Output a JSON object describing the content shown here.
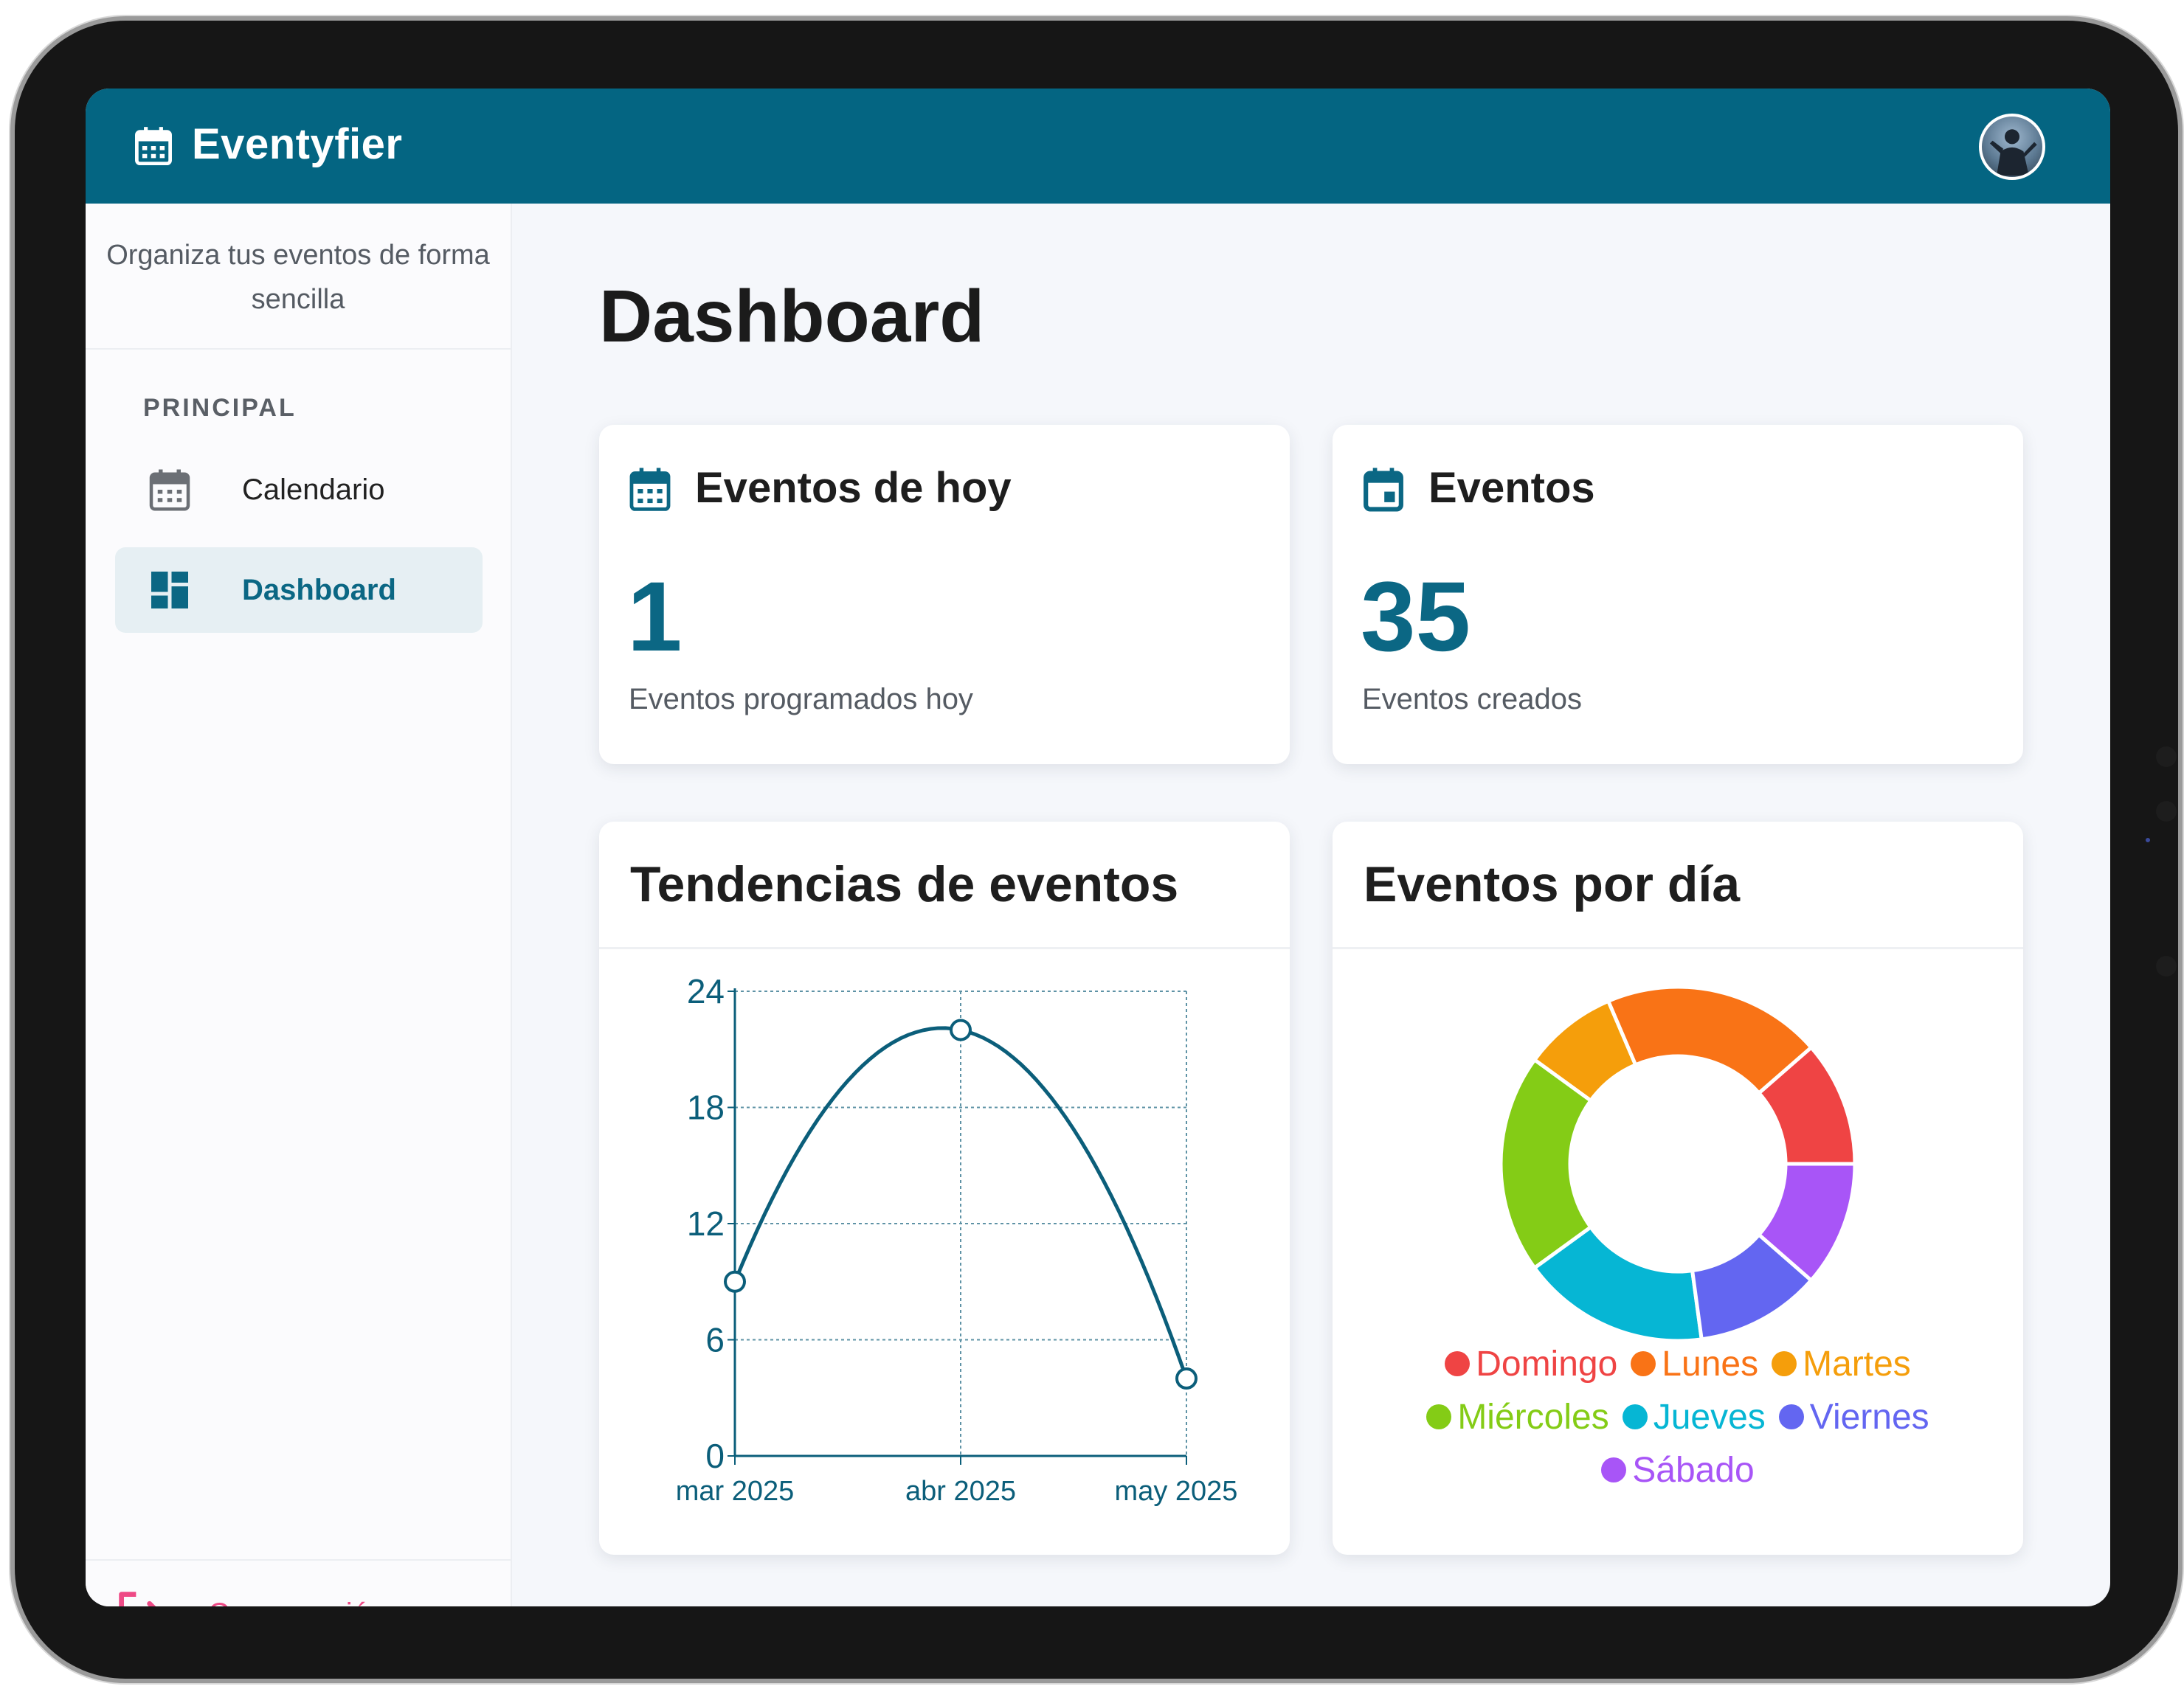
{
  "app": {
    "name": "Eventyfier",
    "brand_icon": "calendar-icon",
    "accent_color": "#046582"
  },
  "sidebar": {
    "tagline": "Organiza tus eventos de forma sencilla",
    "section_label": "PRINCIPAL",
    "items": [
      {
        "label": "Calendario",
        "icon": "calendar-icon",
        "active": false
      },
      {
        "label": "Dashboard",
        "icon": "dashboard-icon",
        "active": true
      }
    ],
    "logout_label": "Cerrar sesión",
    "logout_color": "#ee4a86"
  },
  "main": {
    "title": "Dashboard",
    "stats": [
      {
        "title": "Eventos de hoy",
        "icon": "calendar-icon",
        "value": "1",
        "caption": "Eventos programados hoy"
      },
      {
        "title": "Eventos",
        "icon": "event-icon",
        "value": "35",
        "caption": "Eventos creados"
      }
    ]
  },
  "chart_data": [
    {
      "type": "line",
      "title": "Tendencias de eventos",
      "x": [
        "mar 2025",
        "abr 2025",
        "may 2025"
      ],
      "series": [
        {
          "values": [
            9,
            22,
            4
          ],
          "color": "#0b5e7a"
        }
      ],
      "ylim": [
        0,
        24
      ],
      "yticks": [
        "0",
        "6",
        "12",
        "18",
        "24"
      ],
      "grid": true,
      "smooth": true
    },
    {
      "type": "pie",
      "title": "Eventos por día",
      "donut": true,
      "legend_position": "bottom",
      "labels": [
        "Domingo",
        "Lunes",
        "Martes",
        "Miércoles",
        "Jueves",
        "Viernes",
        "Sábado"
      ],
      "values": [
        4,
        7,
        3,
        7,
        6,
        4,
        4
      ],
      "colors": [
        "#ef4444",
        "#f97316",
        "#f59e0b",
        "#84cc16",
        "#06b6d4",
        "#6366f1",
        "#a855f7"
      ]
    }
  ]
}
